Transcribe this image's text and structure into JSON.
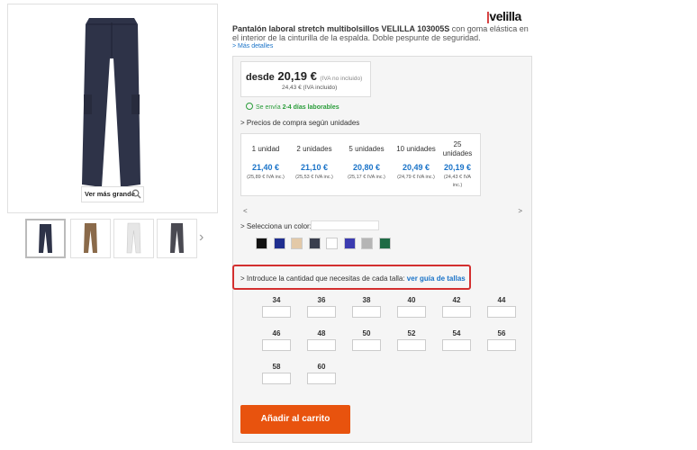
{
  "brand": {
    "name": "velilla",
    "mark": "|"
  },
  "product": {
    "title_bold": "Pantalón laboral stretch multibolsillos VELILLA 103005S",
    "title_rest": " con goma elástica en el interior de la cinturilla de la espalda. Doble pespunte de seguridad.",
    "more_details": "> Más detalles"
  },
  "gallery": {
    "zoom_label": "Ver más grande",
    "thumbs": [
      {
        "name": "navy",
        "color": "#2e3348"
      },
      {
        "name": "brown",
        "color": "#8a6a4a"
      },
      {
        "name": "white",
        "color": "#e6e6e6"
      },
      {
        "name": "charcoal",
        "color": "#4a4a52"
      }
    ],
    "main_color": "#2e3348"
  },
  "price": {
    "desde": "desde",
    "value": "20,19 €",
    "iva_note": "(IVA no incluido)",
    "with_iva": "24,43 € (IVA incluido)"
  },
  "shipping": {
    "prefix": "Se envía ",
    "days": "2-4 días laborables"
  },
  "qty_prices": {
    "label": "> Precios de compra según unidades",
    "tiers": [
      {
        "units": "1 unidad",
        "price": "21,40 €",
        "iva": "(25,89 € IVA inc.)"
      },
      {
        "units": "2 unidades",
        "price": "21,10 €",
        "iva": "(25,53 € IVA inc.)"
      },
      {
        "units": "5 unidades",
        "price": "20,80 €",
        "iva": "(25,17 € IVA inc.)"
      },
      {
        "units": "10 unidades",
        "price": "20,49 €",
        "iva": "(24,79 € IVA inc.)"
      },
      {
        "units": "25 unidades",
        "price": "20,19 €",
        "iva": "(24,43 € IVA inc.)"
      }
    ],
    "prev": "<",
    "next": ">"
  },
  "color": {
    "label": "> Selecciona un color:",
    "value": "",
    "swatches": [
      "#111111",
      "#1f2e8f",
      "#e3c9a8",
      "#3a3f4e",
      "#ffffff",
      "#3b3bb0",
      "#b5b5b5",
      "#1f6b45"
    ]
  },
  "sizes": {
    "label_prefix": "> Introduce la cantidad que necesitas de cada talla: ",
    "guide_link": "ver guía de tallas",
    "values": [
      "34",
      "36",
      "38",
      "40",
      "42",
      "44",
      "46",
      "48",
      "50",
      "52",
      "54",
      "56",
      "58",
      "60"
    ]
  },
  "cart": {
    "label": "Añadir al carrito"
  },
  "accent": "#e8530e",
  "link_color": "#1a73c8"
}
